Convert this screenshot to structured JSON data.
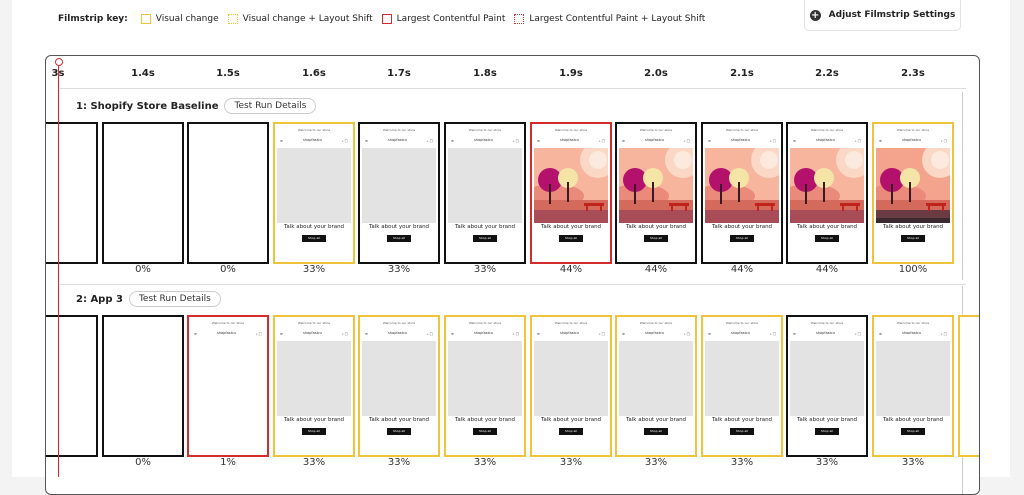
{
  "filmstrip_key": {
    "title": "Filmstrip key:",
    "items": [
      {
        "label": "Visual change",
        "style": "solid",
        "color": "#f0c33c"
      },
      {
        "label": "Visual change + Layout Shift",
        "style": "dotted",
        "color": "#f0c33c"
      },
      {
        "label": "Largest Contentful Paint",
        "style": "solid",
        "color": "#d62b2b"
      },
      {
        "label": "Largest Contentful Paint + Layout Shift",
        "style": "dotted",
        "color": "#d62b2b"
      }
    ]
  },
  "settings": {
    "label": "Adjust Filmstrip Settings",
    "icon": "plus-icon"
  },
  "times": [
    "3s",
    "1.4s",
    "1.5s",
    "1.6s",
    "1.7s",
    "1.8s",
    "1.9s",
    "2.0s",
    "2.1s",
    "2.2s",
    "2.3s"
  ],
  "rows": [
    {
      "title": "1: Shopify Store Baseline",
      "details_label": "Test Run Details",
      "frames": [
        {
          "border": "none",
          "content": "blank",
          "pct": "%"
        },
        {
          "border": "none",
          "content": "blank",
          "pct": "0%"
        },
        {
          "border": "none",
          "content": "blank",
          "pct": "0%"
        },
        {
          "border": "vc",
          "content": "grey",
          "pct": "33%"
        },
        {
          "border": "black",
          "content": "grey",
          "pct": "33%"
        },
        {
          "border": "black",
          "content": "grey",
          "pct": "33%"
        },
        {
          "border": "lcp",
          "content": "image",
          "pct": "44%"
        },
        {
          "border": "black",
          "content": "image",
          "pct": "44%"
        },
        {
          "border": "black",
          "content": "image",
          "pct": "44%"
        },
        {
          "border": "black",
          "content": "image",
          "pct": "44%"
        },
        {
          "border": "vc",
          "content": "image-full",
          "pct": "100%"
        }
      ]
    },
    {
      "title": "2: App 3",
      "details_label": "Test Run Details",
      "frames": [
        {
          "border": "none",
          "content": "blank",
          "pct": "%"
        },
        {
          "border": "none",
          "content": "blank",
          "pct": "0%"
        },
        {
          "border": "lcp",
          "content": "header-only",
          "pct": "1%"
        },
        {
          "border": "vc",
          "content": "grey",
          "pct": "33%"
        },
        {
          "border": "vc",
          "content": "grey",
          "pct": "33%"
        },
        {
          "border": "vc",
          "content": "grey",
          "pct": "33%"
        },
        {
          "border": "vc",
          "content": "grey",
          "pct": "33%"
        },
        {
          "border": "vc",
          "content": "grey",
          "pct": "33%"
        },
        {
          "border": "vc",
          "content": "grey",
          "pct": "33%"
        },
        {
          "border": "black",
          "content": "grey",
          "pct": "33%"
        },
        {
          "border": "vc",
          "content": "grey",
          "pct": "33%"
        }
      ]
    }
  ],
  "page_text": {
    "announcement": "Welcome to our store",
    "brand": "shopfastcu",
    "tagline": "Talk about your brand",
    "shop_button": "Shop all"
  }
}
